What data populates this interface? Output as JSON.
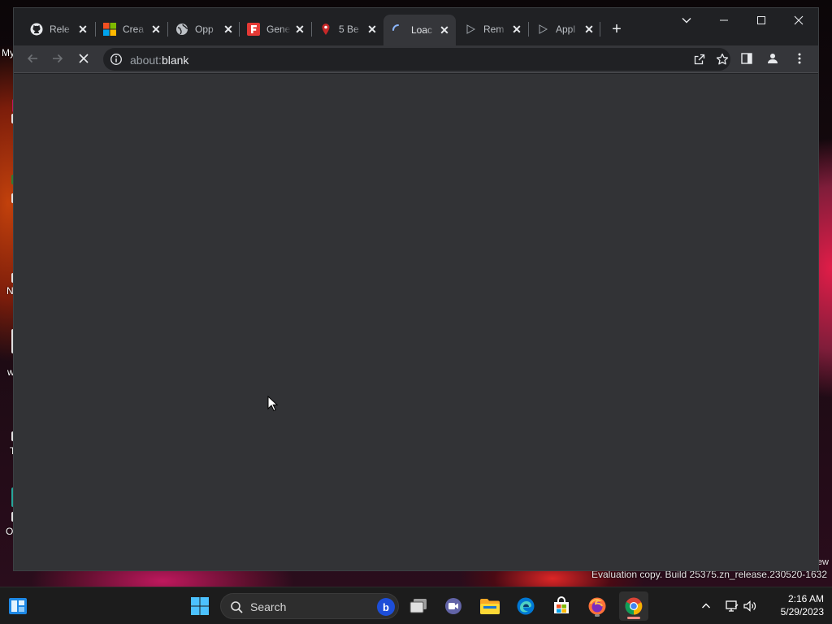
{
  "desktop": {
    "icons": [
      {
        "label": "My",
        "icon": "folder-icon"
      },
      {
        "label": "N",
        "icon": "app-icon"
      },
      {
        "label": "w",
        "icon": "app-icon"
      },
      {
        "label": "T",
        "icon": "app-icon"
      },
      {
        "label": "O",
        "icon": "app-icon"
      }
    ],
    "watermark_tail": "ew",
    "watermark": "Evaluation copy. Build 25375.zn_release.230520-1632"
  },
  "browser": {
    "tabs": [
      {
        "title": "Rele",
        "icon": "github-icon",
        "active": false
      },
      {
        "title": "Crea",
        "icon": "microsoft-icon",
        "active": false
      },
      {
        "title": "Opp",
        "icon": "globe-icon",
        "active": false
      },
      {
        "title": "Gene",
        "icon": "f-logo-icon",
        "active": false
      },
      {
        "title": "5 Be",
        "icon": "pin-icon",
        "active": false
      },
      {
        "title": "Loac",
        "icon": "loading-icon",
        "active": true
      },
      {
        "title": "Rem",
        "icon": "play-icon",
        "active": false
      },
      {
        "title": "Appl",
        "icon": "play-icon",
        "active": false
      }
    ],
    "new_tab_label": "+",
    "address": {
      "scheme": "about:",
      "rest": "blank"
    }
  },
  "taskbar": {
    "search_label": "Search",
    "bing_label": "b",
    "clock": {
      "time": "2:16 AM",
      "date": "5/29/2023"
    }
  },
  "colors": {
    "viewport": "#323336",
    "tabstrip": "#202124",
    "toolbar": "#35363a",
    "taskbar": "#1c1c1c",
    "chrome_indicator": "#f28b82"
  }
}
